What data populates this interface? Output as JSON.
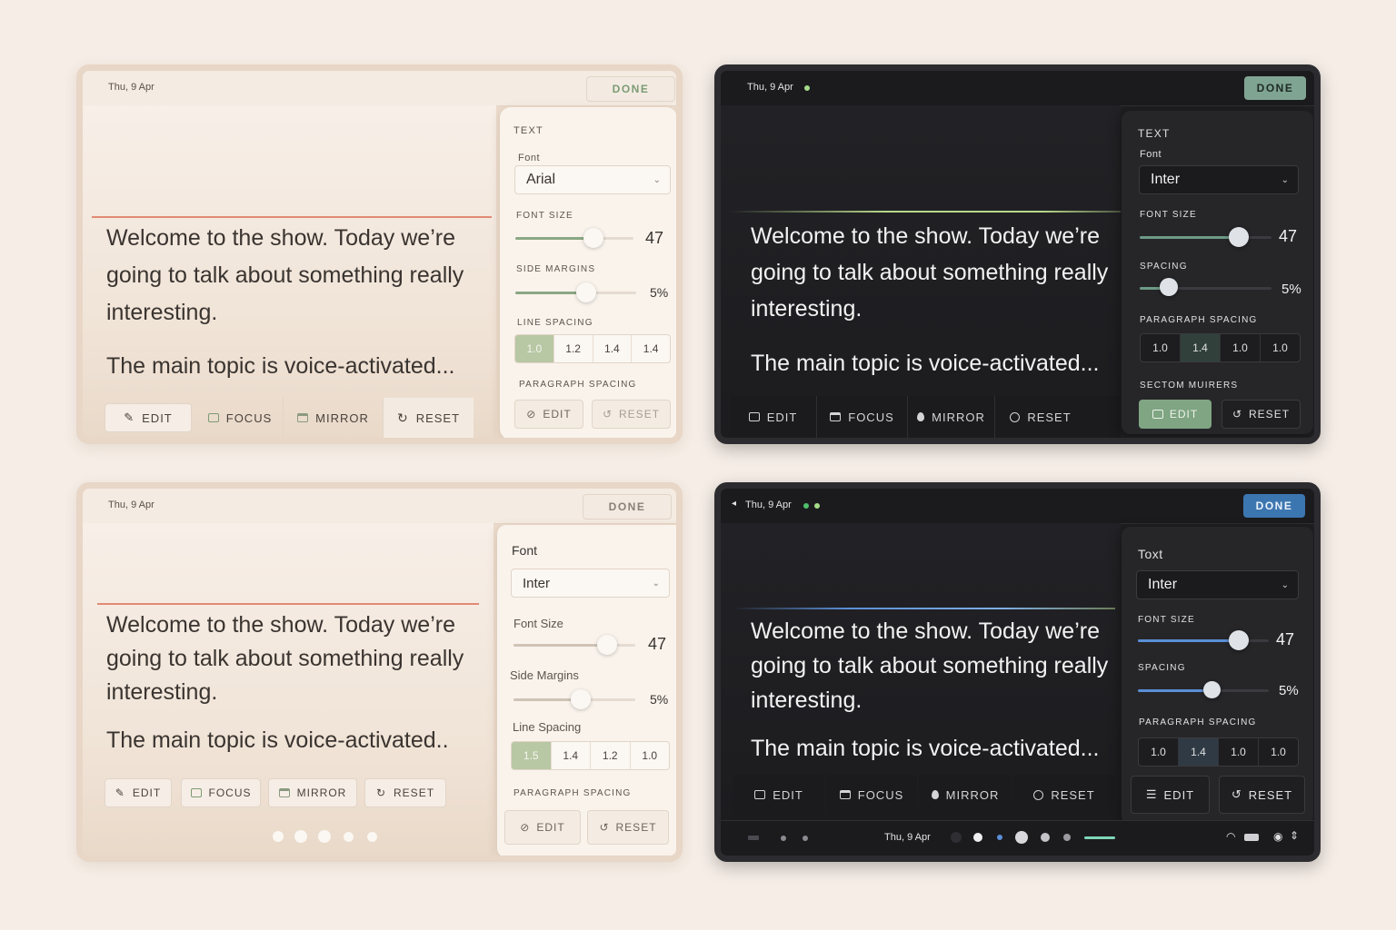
{
  "panels": {
    "p1": {
      "date": "Thu, 9 Apr",
      "done": "DONE",
      "script": [
        "Welcome to the show. Today we’re going to talk about something really interesting.",
        "The main topic is voice-activated..."
      ],
      "toolbar": [
        "EDIT",
        "FOCUS",
        "MIRROR",
        "RESET"
      ],
      "side": {
        "section": "TEXT",
        "font_label": "Font",
        "font_value": "Arial",
        "size_label": "FONT SIZE",
        "size_value": "47",
        "margins_label": "SIDE MARGINS",
        "margins_value": "5%",
        "line_label": "LINE SPACING",
        "line_options": [
          "1.0",
          "1.2",
          "1.4",
          "1.4"
        ],
        "para_label": "PARAGRAPH SPACING",
        "edit": "EDIT",
        "reset": "RESET"
      }
    },
    "p2": {
      "date": "Thu, 9 Apr",
      "done": "DONE",
      "script": [
        "Welcome to the show. Today we’re going to talk about something really interesting.",
        "The main topic is voice-activated..."
      ],
      "toolbar": [
        "EDIT",
        "FOCUS",
        "MIRROR",
        "RESET"
      ],
      "side": {
        "section": "TEXT",
        "font_label": "Font",
        "font_value": "Inter",
        "size_label": "FONT SIZE",
        "size_value": "47",
        "spacing_label": "SPACING",
        "spacing_value": "5%",
        "para_label": "PARAGRAPH SPACING",
        "para_options": [
          "1.0",
          "1.4",
          "1.0",
          "1.0"
        ],
        "section2": "SECTOM MUIRERS",
        "edit": "EDIT",
        "reset": "RESET"
      }
    },
    "p3": {
      "date": "Thu, 9 Apr",
      "done": "DONE",
      "script": [
        "Welcome to the show. Today we’re going to talk about something really interesting.",
        "The main topic is voice-activated.."
      ],
      "toolbar": [
        "EDIT",
        "FOCUS",
        "MIRROR",
        "RESET"
      ],
      "side": {
        "font_label": "Font",
        "font_value": "Inter",
        "size_label": "Font Size",
        "size_value": "47",
        "margins_label": "Side Margins",
        "margins_value": "5%",
        "line_label": "Line Spacing",
        "line_options": [
          "1.5",
          "1.4",
          "1.2",
          "1.0"
        ],
        "para_label": "PARAGRAPH SPACING",
        "edit": "EDIT",
        "reset": "RESET"
      }
    },
    "p4": {
      "date": "Thu, 9 Apr",
      "done": "DONE",
      "script": [
        "Welcome to the show. Today we’re going to talk about something really interesting.",
        "The main topic is voice-activated..."
      ],
      "toolbar": [
        "EDIT",
        "FOCUS",
        "MIRROR",
        "RESET"
      ],
      "bottom_date": "Thu, 9 Apr",
      "side": {
        "section": "Toxt",
        "font_value": "Inter",
        "size_label": "FONT SIZE",
        "size_value": "47",
        "spacing_label": "SPACING",
        "spacing_value": "5%",
        "para_label": "PARAGRAPH SPACING",
        "para_options": [
          "1.0",
          "1.4",
          "1.0",
          "1.0"
        ],
        "edit": "EDIT",
        "reset": "RESET"
      }
    }
  },
  "levels": {
    "p1_size": 0.67,
    "p1_margins": 0.6,
    "p2_size": 0.72,
    "p2_spacing": 0.2,
    "p3_size": 0.78,
    "p3_margins": 0.56,
    "p4_size": 0.8,
    "p4_spacing": 0.5
  },
  "colors": {
    "sage": "#8aa783",
    "sage_text": "#7c9b74",
    "dark_accent": "#6d9a86",
    "blue_done": "#3c76b0",
    "red_cue": "#e28a74",
    "green_cue": "#b8d88a",
    "blue_cue": "#5b8fd6"
  },
  "icons": [
    "pencil-icon",
    "focus-icon",
    "mirror-icon",
    "reset-icon",
    "chevron-down-icon"
  ]
}
